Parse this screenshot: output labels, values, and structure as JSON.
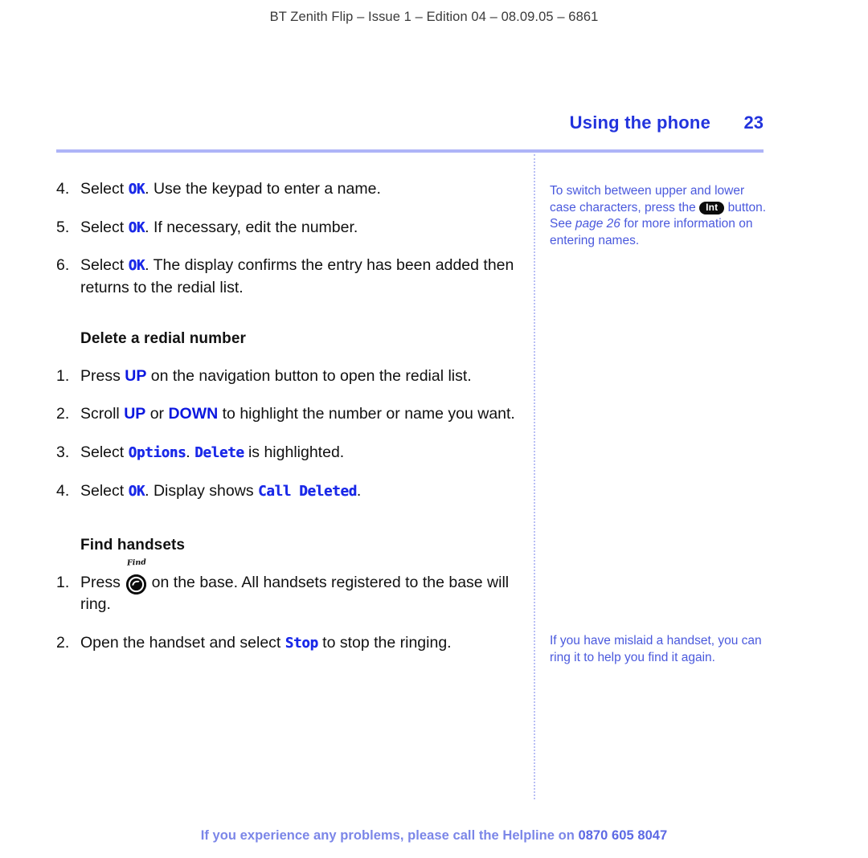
{
  "header": {
    "running_head": "BT Zenith Flip – Issue 1 – Edition 04 – 08.09.05 – 6861"
  },
  "page_title": {
    "text": "Using the phone",
    "page_number": "23"
  },
  "colors": {
    "title_blue": "#2233dd",
    "lcd_blue": "#1a29e8",
    "key_blue": "#0b17e0",
    "note_blue": "#4a59dd",
    "rule_periwinkle": "#aeb4f7",
    "divider_dotted": "#b9bff5",
    "footer_blue": "#7b86e8",
    "badge_black": "#0b0b0b"
  },
  "main": {
    "continued_steps": [
      {
        "number": "4.",
        "parts": [
          {
            "type": "text",
            "value": "Select "
          },
          {
            "type": "lcd",
            "value": "OK"
          },
          {
            "type": "text",
            "value": ". Use the keypad to enter a name."
          }
        ]
      },
      {
        "number": "5.",
        "parts": [
          {
            "type": "text",
            "value": "Select "
          },
          {
            "type": "lcd",
            "value": "OK"
          },
          {
            "type": "text",
            "value": ". If necessary, edit the number."
          }
        ]
      },
      {
        "number": "6.",
        "parts": [
          {
            "type": "text",
            "value": "Select "
          },
          {
            "type": "lcd",
            "value": "OK"
          },
          {
            "type": "text",
            "value": ". The display confirms the entry has been added then returns to the redial list."
          }
        ]
      }
    ],
    "sections": [
      {
        "heading": "Delete a redial number",
        "steps": [
          {
            "number": "1.",
            "parts": [
              {
                "type": "text",
                "value": "Press "
              },
              {
                "type": "key",
                "value": "UP"
              },
              {
                "type": "text",
                "value": " on the navigation button to open the redial list."
              }
            ]
          },
          {
            "number": "2.",
            "parts": [
              {
                "type": "text",
                "value": "Scroll "
              },
              {
                "type": "key",
                "value": "UP"
              },
              {
                "type": "text",
                "value": " or "
              },
              {
                "type": "key",
                "value": "DOWN"
              },
              {
                "type": "text",
                "value": " to highlight the number or name you want."
              }
            ]
          },
          {
            "number": "3.",
            "parts": [
              {
                "type": "text",
                "value": "Select "
              },
              {
                "type": "lcd",
                "value": "Options"
              },
              {
                "type": "text",
                "value": ". "
              },
              {
                "type": "lcd",
                "value": "Delete"
              },
              {
                "type": "text",
                "value": " is highlighted."
              }
            ]
          },
          {
            "number": "4.",
            "parts": [
              {
                "type": "text",
                "value": "Select "
              },
              {
                "type": "lcd",
                "value": "OK"
              },
              {
                "type": "text",
                "value": ". Display shows "
              },
              {
                "type": "lcd",
                "value": "Call Deleted"
              },
              {
                "type": "text",
                "value": "."
              }
            ]
          }
        ]
      },
      {
        "heading": "Find handsets",
        "steps": [
          {
            "number": "1.",
            "parts": [
              {
                "type": "text",
                "value": "Press "
              },
              {
                "type": "icon",
                "value": "find-button-icon",
                "label": "Find"
              },
              {
                "type": "text",
                "value": " on the base. All handsets registered to the base will ring."
              }
            ]
          },
          {
            "number": "2.",
            "parts": [
              {
                "type": "text",
                "value": "Open the handset and select "
              },
              {
                "type": "lcd",
                "value": "Stop"
              },
              {
                "type": "text",
                "value": " to stop the ringing."
              }
            ]
          }
        ]
      }
    ]
  },
  "sidebar": {
    "notes": [
      {
        "parts": [
          {
            "type": "text",
            "value": "To switch between upper and lower case characters, press the "
          },
          {
            "type": "pill",
            "value": "Int"
          },
          {
            "type": "text",
            "value": " button. See "
          },
          {
            "type": "italic",
            "value": "page 26"
          },
          {
            "type": "text",
            "value": " for more information on entering names."
          }
        ]
      },
      {
        "parts": [
          {
            "type": "text",
            "value": "If you have mislaid a handset, you can ring it to help you find it again."
          }
        ]
      }
    ]
  },
  "footer": {
    "text": "If you experience any problems, please call the Helpline on ",
    "phone": "0870 605 8047"
  }
}
